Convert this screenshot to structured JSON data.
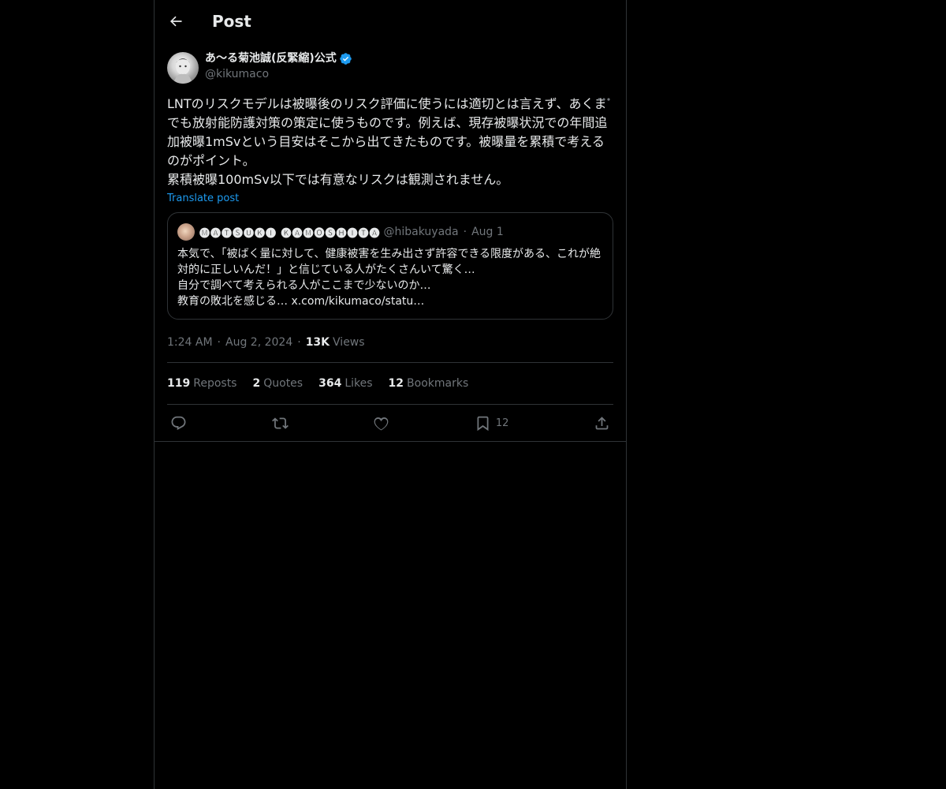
{
  "header": {
    "title": "Post"
  },
  "post": {
    "author_name": "あ〜る菊池誠(反緊縮)公式",
    "handle": "@kikumaco",
    "text": "LNTのリスクモデルは被曝後のリスク評価に使うには適切とは言えず、あくまでも放射能防護対策の策定に使うものです。例えば、現存被曝状況での年間追加被曝1mSvという目安はそこから出てきたものです。被曝量を累積で考えるのがポイント。\n累積被曝100mSv以下では有意なリスクは観測されません。",
    "translate_label": "Translate post",
    "time": "1:24 AM",
    "date": "Aug 2, 2024",
    "views_count": "13K",
    "views_label": "Views"
  },
  "quote": {
    "name": "🅜🅐🅣🅢🅤🅚🅘 🅚🅐🅜🅞🅢🅗🅘🅣🅐",
    "handle": "@hibakuyada",
    "date": "Aug 1",
    "text": "本気で、「被ばく量に対して、健康被害を生み出さず許容できる限度がある、これが絶対的に正しいんだ！」と信じている人がたくさんいて驚く…\n自分で調べて考えられる人がここまで少ないのか…\n教育の敗北を感じる… x.com/kikumaco/statu…"
  },
  "stats": {
    "reposts_count": "119",
    "reposts_label": "Reposts",
    "quotes_count": "2",
    "quotes_label": "Quotes",
    "likes_count": "364",
    "likes_label": "Likes",
    "bookmarks_count": "12",
    "bookmarks_label": "Bookmarks"
  },
  "actions": {
    "bookmark_count": "12"
  },
  "icons": {
    "back": "arrow-left-icon",
    "verified": "verified-badge-icon",
    "more": "more-horizontal-icon",
    "reply": "reply-icon",
    "repost": "repost-icon",
    "like": "heart-icon",
    "bookmark": "bookmark-icon",
    "share": "share-icon"
  },
  "colors": {
    "background": "#000000",
    "text": "#e7e9ea",
    "muted": "#71767b",
    "accent": "#1d9bf0",
    "border": "#2f3336"
  }
}
